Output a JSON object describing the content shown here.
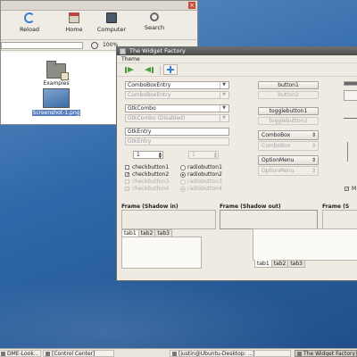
{
  "file_manager": {
    "toolbar": {
      "reload": "Reload",
      "home": "Home",
      "computer": "Computer",
      "search": "Search"
    },
    "zoom": "100%",
    "files": [
      {
        "label": "Examples",
        "kind": "folder"
      },
      {
        "label": "Screenshot-1.png",
        "kind": "image",
        "selected": true
      }
    ]
  },
  "widget_factory": {
    "title": "The Widget Factory",
    "menu": "Theme",
    "combo_entries": [
      {
        "text": "ComboBoxEntry",
        "disabled": false
      },
      {
        "text": "ComboBoxEntry",
        "disabled": true
      },
      {
        "text": "GtkCombo",
        "disabled": false
      },
      {
        "text": "GtkCombo (Disabled)",
        "disabled": true
      }
    ],
    "entries": [
      {
        "text": "GtkEntry",
        "disabled": false
      },
      {
        "text": "GtkEntry",
        "disabled": true
      }
    ],
    "spinners": [
      {
        "value": "1",
        "disabled": false
      },
      {
        "value": "1",
        "disabled": true
      }
    ],
    "checks": [
      {
        "label": "checkbutton1",
        "checked": false,
        "disabled": false
      },
      {
        "label": "checkbutton2",
        "checked": true,
        "disabled": false
      },
      {
        "label": "checkbutton3",
        "checked": false,
        "disabled": true
      },
      {
        "label": "checkbutton4",
        "checked": true,
        "disabled": true
      }
    ],
    "radios": [
      {
        "label": "radiobutton1",
        "checked": false,
        "disabled": false
      },
      {
        "label": "radiobutton2",
        "checked": true,
        "disabled": false
      },
      {
        "label": "radiobutton3",
        "checked": false,
        "disabled": true
      },
      {
        "label": "radiobutton4",
        "checked": true,
        "disabled": true
      }
    ],
    "buttons": {
      "button1": "button1",
      "button2": "button2",
      "toggle1": "togglebutton1",
      "toggle2": "togglebutton2"
    },
    "comboboxes": {
      "enabled": "ComboBox",
      "disabled": "ComboBox"
    },
    "optionmenus": {
      "enabled": "OptionMenu",
      "disabled": "OptionMenu"
    },
    "frames": {
      "shadow_in": "Frame (Shadow in)",
      "shadow_out": "Frame (Shadow out)",
      "third": "Frame (S"
    },
    "tabs_top": [
      "tab1",
      "tab2",
      "tab3"
    ],
    "tabs_bottom": [
      "tab1",
      "tab2",
      "tab3"
    ],
    "partial_check_label": "M"
  },
  "taskbar": {
    "items": [
      {
        "label": "DME-Look...",
        "active": false
      },
      {
        "label": "[Control Center]",
        "active": false
      },
      {
        "label": "[justin@Ubuntu-Desktop: ...]",
        "active": false
      },
      {
        "label": "The Widget Factory",
        "active": true
      }
    ]
  },
  "colors": {
    "desktop": "#2f68a8",
    "window_bg": "#efebe3",
    "titlebar": "#4a4a4a",
    "selection": "#5b7fc0",
    "toolbar_green": "#4b9e3c"
  }
}
